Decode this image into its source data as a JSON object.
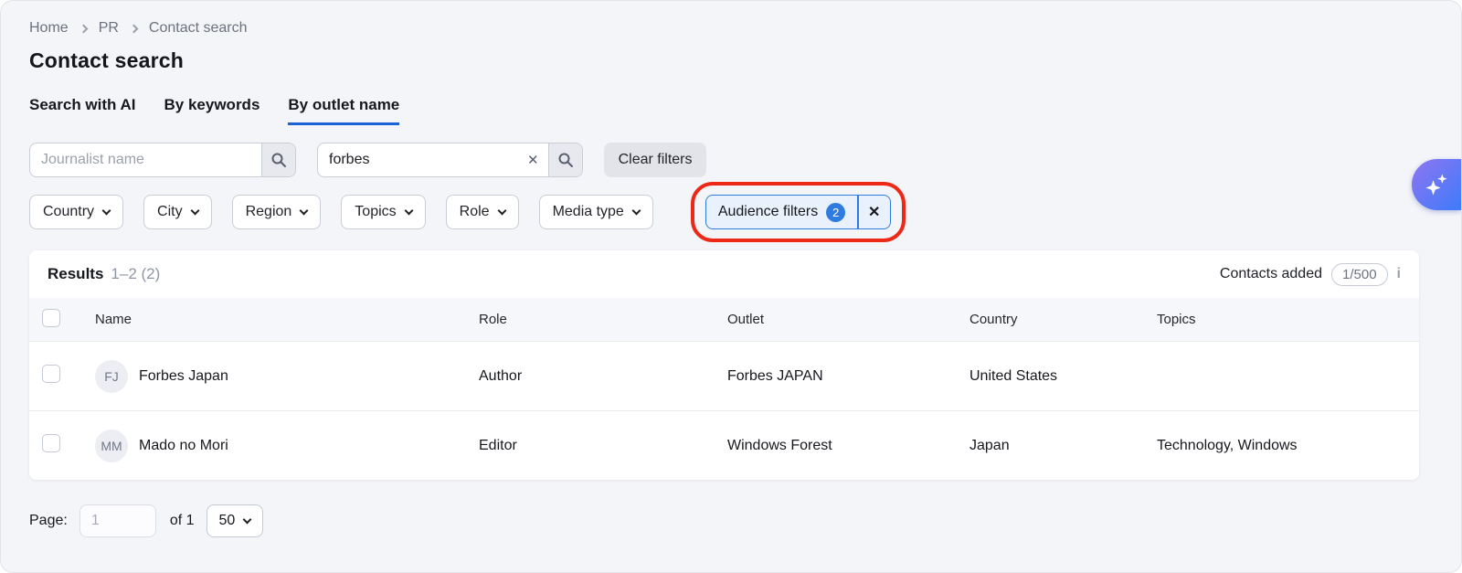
{
  "breadcrumb": {
    "items": [
      "Home",
      "PR",
      "Contact search"
    ]
  },
  "header": {
    "title": "Contact search"
  },
  "tabs": [
    {
      "label": "Search with AI",
      "active": false
    },
    {
      "label": "By keywords",
      "active": false
    },
    {
      "label": "By outlet name",
      "active": true
    }
  ],
  "search": {
    "journalist_placeholder": "Journalist name",
    "outlet_value": "forbes",
    "clear_filters_label": "Clear filters"
  },
  "filters": {
    "dropdowns": [
      "Country",
      "City",
      "Region",
      "Topics",
      "Role",
      "Media type"
    ],
    "audience": {
      "label": "Audience filters",
      "count": "2"
    }
  },
  "results": {
    "title": "Results",
    "range": "1–2 (2)",
    "contacts_added_label": "Contacts added",
    "contacts_added_count": "1/500"
  },
  "table": {
    "columns": [
      "Name",
      "Role",
      "Outlet",
      "Country",
      "Topics"
    ],
    "rows": [
      {
        "initials": "FJ",
        "name": "Forbes Japan",
        "role": "Author",
        "outlet": "Forbes JAPAN",
        "country": "United States",
        "topics": ""
      },
      {
        "initials": "MM",
        "name": "Mado no Mori",
        "role": "Editor",
        "outlet": "Windows Forest",
        "country": "Japan",
        "topics": "Technology, Windows"
      }
    ]
  },
  "pagination": {
    "page_label": "Page:",
    "page_value": "1",
    "of_label": "of 1",
    "page_size": "50"
  },
  "icons": {
    "close_glyph": "✕",
    "info_glyph": "i"
  },
  "colors": {
    "accent_blue": "#2e7ce0",
    "tab_underline": "#1a63d8",
    "annotation_red": "#ee2817",
    "fab_gradient_start": "#8f75f2",
    "fab_gradient_end": "#3e7bfa",
    "page_background": "#f4f5f9"
  }
}
